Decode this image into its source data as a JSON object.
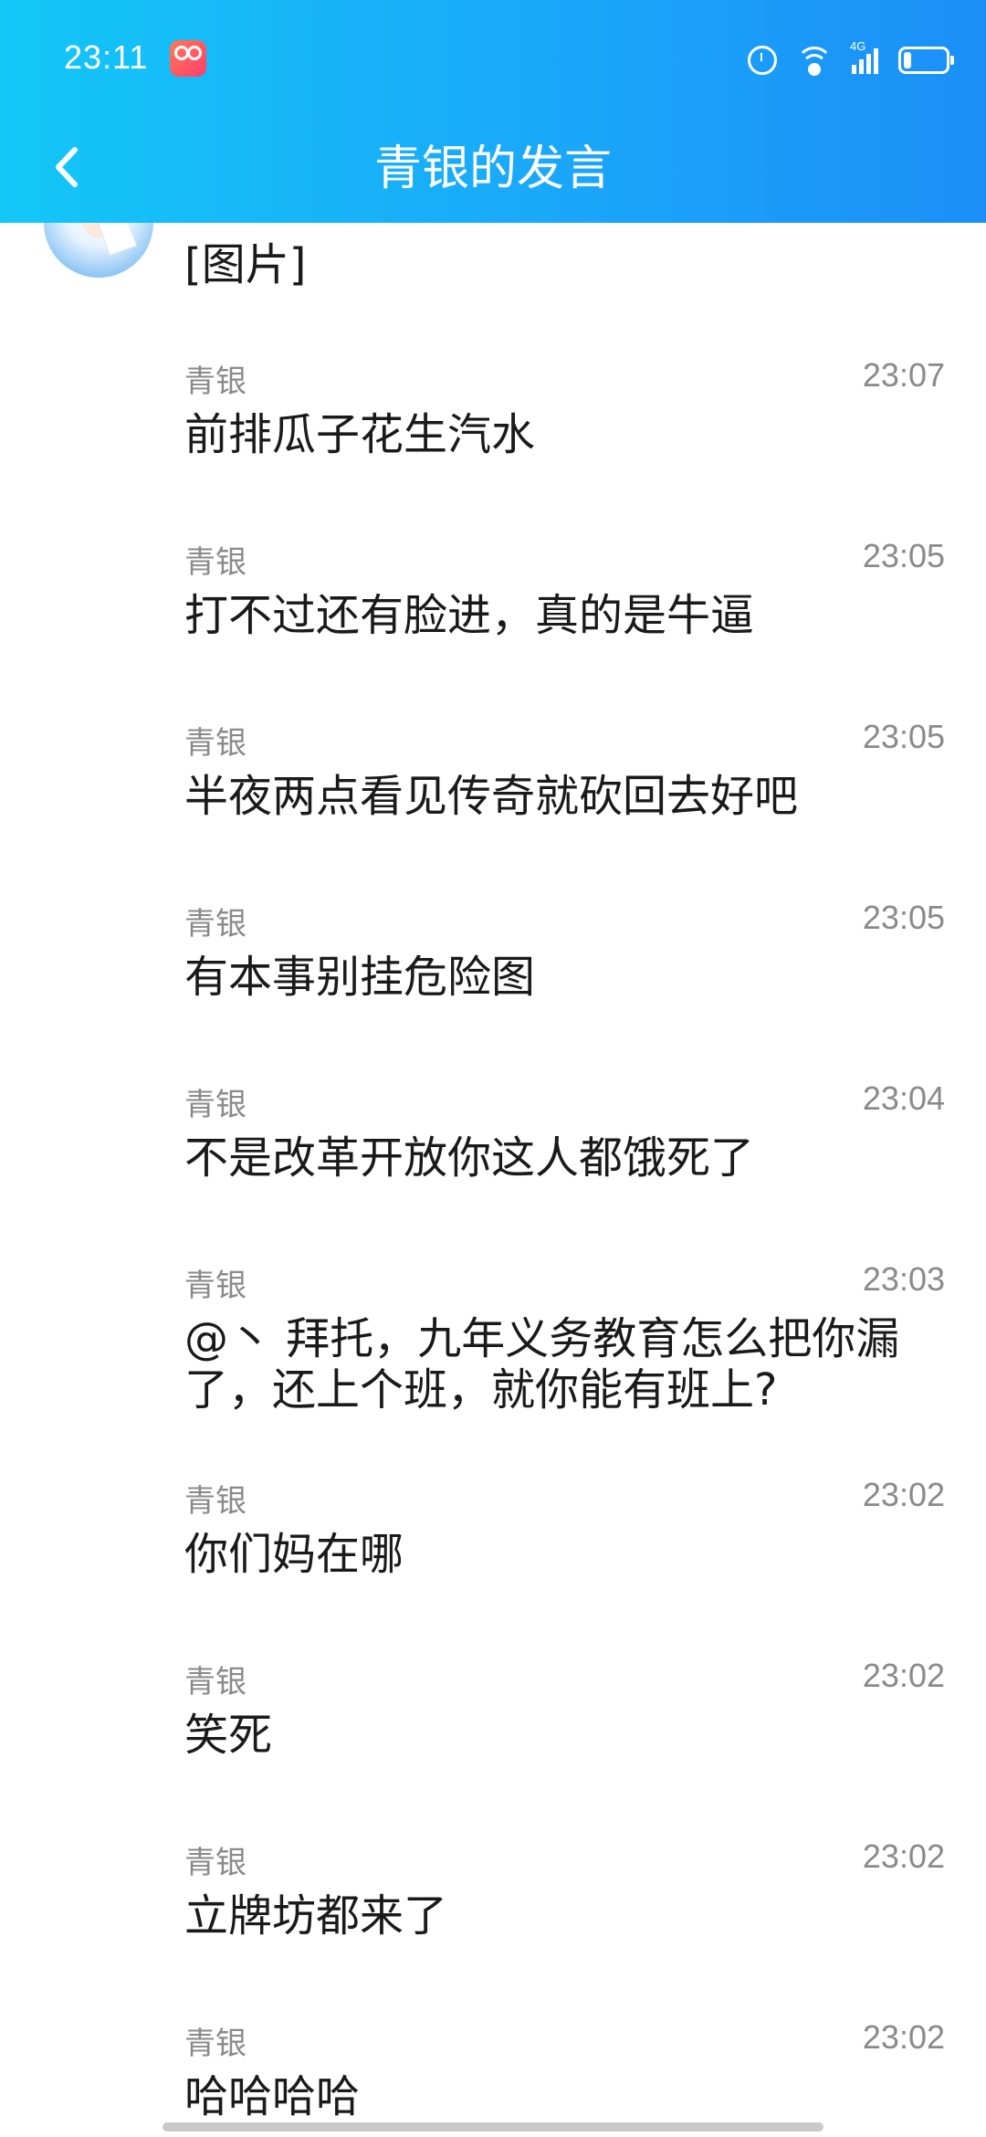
{
  "status_bar": {
    "time": "23:11",
    "network_label": "4G"
  },
  "header": {
    "title": "青银的发言"
  },
  "partial_message": {
    "text": "[图片]"
  },
  "messages": [
    {
      "name": "青银",
      "time": "23:07",
      "text": "前排瓜子花生汽水"
    },
    {
      "name": "青银",
      "time": "23:05",
      "text": "打不过还有脸进，真的是牛逼"
    },
    {
      "name": "青银",
      "time": "23:05",
      "text": "半夜两点看见传奇就砍回去好吧"
    },
    {
      "name": "青银",
      "time": "23:05",
      "text": "有本事别挂危险图"
    },
    {
      "name": "青银",
      "time": "23:04",
      "text": "不是改革开放你这人都饿死了"
    },
    {
      "name": "青银",
      "time": "23:03",
      "text": "@丶 拜托，九年义务教育怎么把你漏了，还上个班，就你能有班上?"
    },
    {
      "name": "青银",
      "time": "23:02",
      "text": "你们妈在哪"
    },
    {
      "name": "青银",
      "time": "23:02",
      "text": "笑死"
    },
    {
      "name": "青银",
      "time": "23:02",
      "text": "立牌坊都来了"
    },
    {
      "name": "青银",
      "time": "23:02",
      "text": "哈哈哈哈"
    }
  ]
}
